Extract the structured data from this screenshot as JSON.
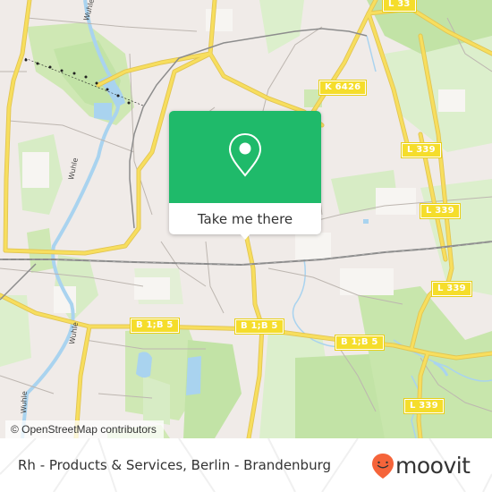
{
  "map": {
    "road_labels": [
      {
        "id": "l33",
        "text": "L 33"
      },
      {
        "id": "k6426",
        "text": "K 6426"
      },
      {
        "id": "l339-a",
        "text": "L 339"
      },
      {
        "id": "l339-b",
        "text": "L 339"
      },
      {
        "id": "l339-c",
        "text": "L 339"
      },
      {
        "id": "l339-d",
        "text": "L 339"
      },
      {
        "id": "b1b5-a",
        "text": "B 1;B 5"
      },
      {
        "id": "b1b5-b",
        "text": "B 1;B 5"
      },
      {
        "id": "b1b5-c",
        "text": "B 1;B 5"
      }
    ],
    "street_labels": [
      {
        "id": "wuhle-1",
        "text": "Wuhle"
      },
      {
        "id": "wuhle-2",
        "text": "Wuhle"
      },
      {
        "id": "wuhle-3",
        "text": "Wuhle"
      },
      {
        "id": "wuhle-4",
        "text": "Wuhle"
      }
    ],
    "attribution": "© OpenStreetMap contributors",
    "colors": {
      "land": "#f0ebe8",
      "park": "#cfe8b4",
      "forest": "#c2e3a6",
      "water": "#a9d3ef",
      "major_road": "#f7de5e",
      "rail": "#8c8c8c",
      "brand_green": "#1fba6a",
      "moovit_orange": "#f5643a"
    }
  },
  "popup": {
    "icon": "location-pin-icon",
    "cta_label": "Take me there"
  },
  "footer": {
    "place_title": "Rh - Products & Services, Berlin - Brandenburg",
    "logo_text": "moovit",
    "logo_icon": "moovit-smiley-pin-icon"
  }
}
